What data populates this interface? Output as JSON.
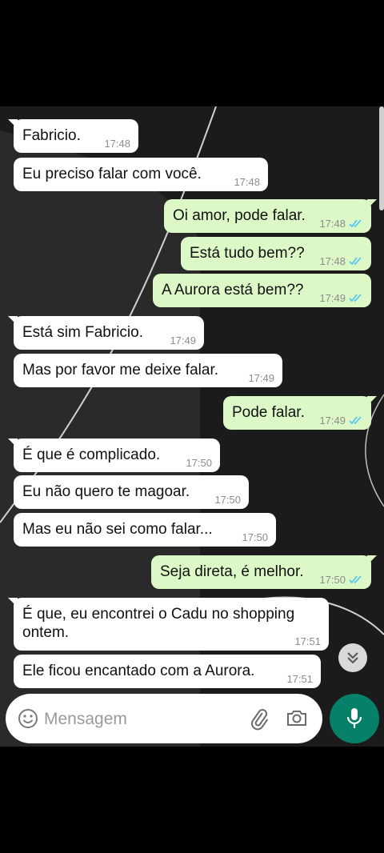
{
  "messages": [
    {
      "dir": "in",
      "text": "Fabricio.",
      "time": "17:48"
    },
    {
      "dir": "in",
      "text": "Eu preciso falar com você.",
      "time": "17:48"
    },
    {
      "dir": "out",
      "text": "Oi amor, pode falar.",
      "time": "17:48",
      "status": "read"
    },
    {
      "dir": "out",
      "text": "Está tudo bem??",
      "time": "17:48",
      "status": "read"
    },
    {
      "dir": "out",
      "text": "A Aurora está bem??",
      "time": "17:49",
      "status": "read"
    },
    {
      "dir": "in",
      "text": "Está sim Fabricio.",
      "time": "17:49"
    },
    {
      "dir": "in",
      "text": "Mas por favor me deixe falar.",
      "time": "17:49"
    },
    {
      "dir": "out",
      "text": "Pode falar.",
      "time": "17:49",
      "status": "read"
    },
    {
      "dir": "in",
      "text": "É que é complicado.",
      "time": "17:50"
    },
    {
      "dir": "in",
      "text": "Eu não quero te magoar.",
      "time": "17:50"
    },
    {
      "dir": "in",
      "text": "Mas eu não sei como falar...",
      "time": "17:50"
    },
    {
      "dir": "out",
      "text": "Seja direta, é melhor.",
      "time": "17:50",
      "status": "read"
    },
    {
      "dir": "in",
      "text": "É que, eu encontrei o Cadu no shopping ontem.",
      "time": "17:51"
    },
    {
      "dir": "in",
      "text": "Ele ficou encantado com a Aurora.",
      "time": "17:51"
    }
  ],
  "composer": {
    "placeholder": "Mensagem",
    "icons": [
      "emoji-icon",
      "attach-icon",
      "camera-icon"
    ]
  },
  "actions": {
    "mic_icon": "mic-icon",
    "scroll_icon": "chevron-double-down-icon"
  },
  "colors": {
    "incoming": "#ffffff",
    "outgoing": "#dcf8c6",
    "read_ticks": "#4fc3f7",
    "send_button": "#078069"
  }
}
